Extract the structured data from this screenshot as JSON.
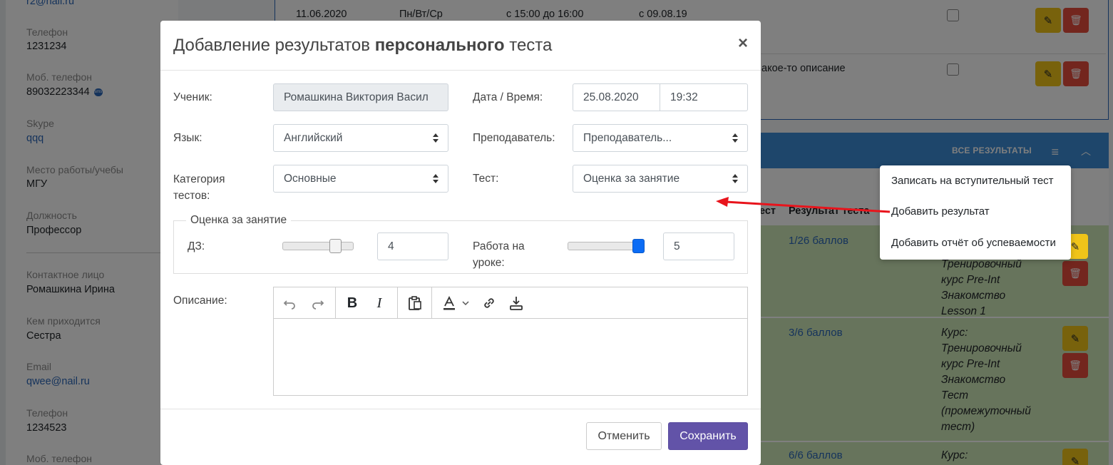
{
  "background": {
    "contact": {
      "email_top": "r2@nail.ru",
      "phone_label": "Телефон",
      "phone_value": "1231234",
      "mobile_label": "Моб. телефон",
      "mobile_value": "89032223344",
      "skype_label": "Skype",
      "skype_value": "qqq",
      "work_label": "Место работы/учебы",
      "work_value": "МГУ",
      "position_label": "Должность",
      "position_value": "Профессор",
      "contact_person_label": "Контактное лицо",
      "contact_person_value": "Ромашкина Ирина",
      "relation_label": "Кем приходится",
      "relation_value": "Сестра",
      "email_label": "Email",
      "email_value": "qwee@nail.ru",
      "phone2_label": "Телефон",
      "phone2_value": "1234523",
      "mobile2_label": "Моб. телефон"
    },
    "schedule_row": {
      "date": "11.06.2020",
      "days": "Пн/Вт/Ср",
      "time": "с 15:00 до 16:00",
      "since": "с 09.08.19",
      "description": "акое-то описание"
    },
    "results_panel": {
      "all_results": "ВСЕ РЕЗУЛЬТАТЫ",
      "col_test_fragment": "ест",
      "col_result": "Результат теста",
      "rows": [
        {
          "score": "1/26 баллов",
          "desc": [
            "Тренировочный",
            "курс Pre-Int",
            "Знакомство",
            "Lesson 1"
          ]
        },
        {
          "score": "3/6 баллов",
          "desc": [
            "Курс:",
            "Тренировочный",
            "курс Pre-Int",
            "Знакомство",
            "Тест",
            "(промежуточный",
            "тест)"
          ]
        },
        {
          "score": "6/6 баллов",
          "desc": [
            "Курс:"
          ]
        }
      ]
    },
    "dropdown_menu": {
      "items": [
        "Записать на вступительный тест",
        "Добавить результат",
        "Добавить отчёт об успеваемости"
      ]
    }
  },
  "modal": {
    "title_prefix": "Добавление результатов",
    "title_bold": "персонального",
    "title_suffix": "теста",
    "close": "×",
    "fields": {
      "student_label": "Ученик:",
      "student_value": "Ромашкина Виктория Васил",
      "datetime_label": "Дата / Время:",
      "date_value": "25.08.2020",
      "time_value": "19:32",
      "language_label": "Язык:",
      "language_value": "Английский",
      "teacher_label": "Преподаватель:",
      "teacher_value": "Преподаватель...",
      "category_label_1": "Категория",
      "category_label_2": "тестов:",
      "category_value": "Основные",
      "test_label": "Тест:",
      "test_value": "Оценка за занятие"
    },
    "grading": {
      "legend": "Оценка за занятие",
      "homework_label": "ДЗ:",
      "homework_value": "4",
      "homework_level": 0.8,
      "classwork_label_1": "Работа на",
      "classwork_label_2": "уроке:",
      "classwork_value": "5",
      "classwork_level": 1.0
    },
    "description_label": "Описание:",
    "toolbar_icons": [
      "undo-icon",
      "redo-icon",
      "bold-icon",
      "italic-icon",
      "paste-icon",
      "text-color-icon",
      "link-icon",
      "download-icon"
    ],
    "buttons": {
      "cancel": "Отменить",
      "save": "Сохранить"
    }
  },
  "colors": {
    "primary_button": "#6253a8",
    "header_blue": "#3c8dd6",
    "edit_button": "#f0c419",
    "delete_button": "#e74c3c",
    "row_green": "#cfe8b8",
    "arrow_red": "#e8141c",
    "slider_active": "#0b6cf5"
  }
}
